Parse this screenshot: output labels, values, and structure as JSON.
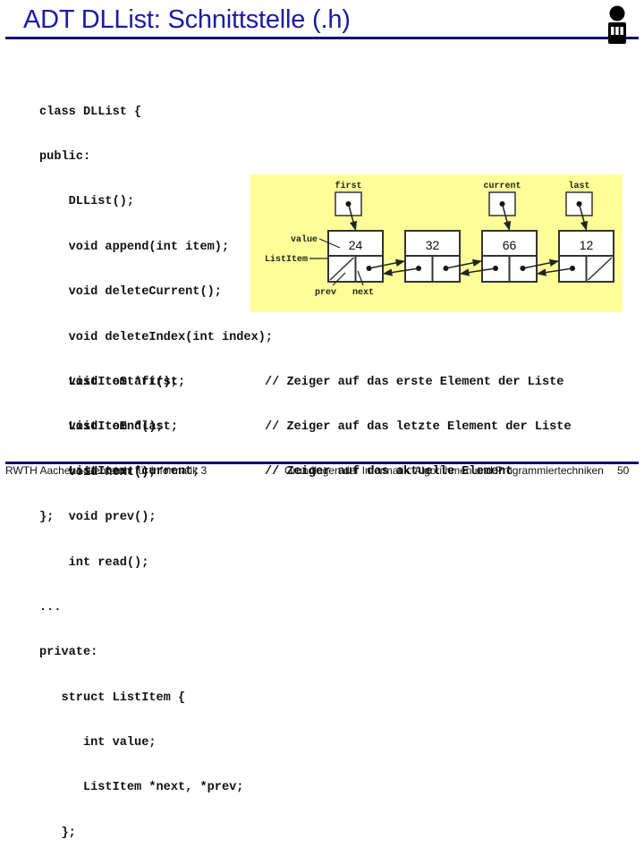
{
  "slide": {
    "title": "ADT DLList: Schnittstelle (.h)",
    "logo_icon": "person-logo-icon"
  },
  "code": {
    "lines": [
      "class DLList {",
      "public:",
      "    DLList();",
      "    void append(int item);",
      "    void deleteCurrent();",
      "    void deleteIndex(int index);",
      "    void toStart();",
      "    void toEnd();",
      "    void next();",
      "    void prev();",
      "    int read();",
      "...",
      "private:",
      "   struct ListItem {",
      "      int value;",
      "      ListItem *next, *prev;",
      "   };"
    ],
    "members": [
      {
        "decl": "    ListItem *first;",
        "comment": "// Zeiger auf das erste Element der Liste"
      },
      {
        "decl": "    ListItem *last;",
        "comment": "// Zeiger auf das letzte Element der Liste"
      },
      {
        "decl": "    ListItem *current;",
        "comment": "// Zeiger auf das aktuelle Element"
      }
    ],
    "closing": "};"
  },
  "diagram": {
    "background": "#ffff99",
    "nodes": [
      {
        "value": "24"
      },
      {
        "value": "32"
      },
      {
        "value": "66"
      },
      {
        "value": "12"
      }
    ],
    "pointers": [
      {
        "label": "first",
        "target_index": 0
      },
      {
        "label": "current",
        "target_index": 2
      },
      {
        "label": "last",
        "target_index": 3
      }
    ],
    "annotations": {
      "value": "value",
      "list_item": "ListItem",
      "prev": "prev",
      "next": "next"
    }
  },
  "footer": {
    "left": "RWTH Aachen – Lehrstuhl für Informatik 3",
    "right": "Grundlagen der Informatik: Algorithmen und Programmiertechniken",
    "page": "50"
  },
  "colors": {
    "title": "#1b1ba8",
    "rule": "#0e0e7a"
  }
}
